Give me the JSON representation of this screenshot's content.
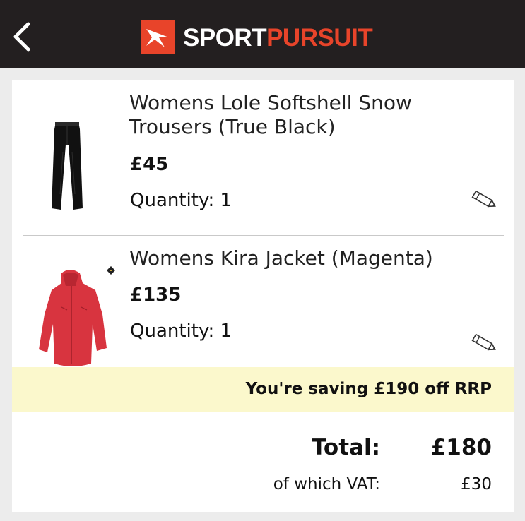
{
  "header": {
    "back_icon": "chevron-left-icon",
    "logo": {
      "part1": "SPORT",
      "part2": "PURSUIT",
      "part1_color": "#ffffff",
      "part2_color": "#e8442a",
      "mark_color": "#e8442a"
    }
  },
  "cart": {
    "items": [
      {
        "name": "Womens Lole Softshell Snow Trousers (True Black)",
        "price": "£45",
        "quantity": "Quantity: 1",
        "edit_icon": "pencil-icon",
        "thumb": "black snow trousers"
      },
      {
        "name": "Womens Kira Jacket (Magenta)",
        "price": "£135",
        "quantity": "Quantity: 1",
        "edit_icon": "pencil-icon",
        "thumb": "magenta jacket"
      }
    ],
    "saving": "You're saving £190 off RRP",
    "total_label": "Total:",
    "total_value": "£180",
    "vat_label": "of which VAT:",
    "vat_value": "£30"
  },
  "colors": {
    "header_bg": "#231f20",
    "saving_bg": "#fbf8cc",
    "accent": "#e8442a"
  }
}
